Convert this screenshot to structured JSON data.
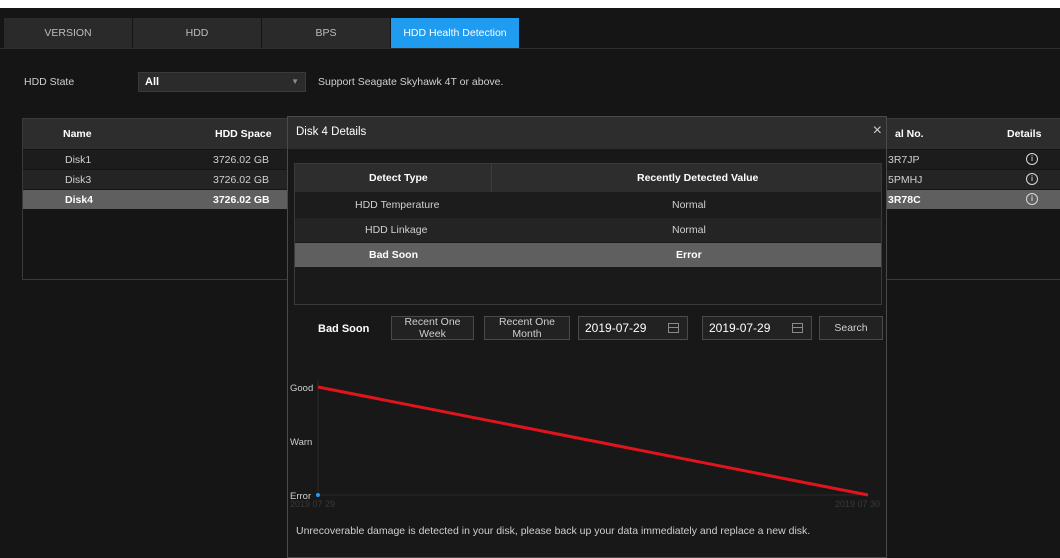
{
  "tabs": [
    {
      "label": "VERSION"
    },
    {
      "label": "HDD"
    },
    {
      "label": "BPS"
    },
    {
      "label": "HDD Health Detection"
    }
  ],
  "filter": {
    "state_label": "HDD State",
    "state_value": "All",
    "support_note": "Support Seagate Skyhawk 4T or above."
  },
  "disk_table": {
    "headers": {
      "name": "Name",
      "space": "HDD Space",
      "serial": "al No.",
      "details": "Details"
    },
    "rows": [
      {
        "name": "Disk1",
        "space": "3726.02 GB",
        "serial": "3R7JP"
      },
      {
        "name": "Disk3",
        "space": "3726.02 GB",
        "serial": "5PMHJ"
      },
      {
        "name": "Disk4",
        "space": "3726.02 GB",
        "serial": "3R78C"
      }
    ],
    "info_glyph": "i"
  },
  "modal": {
    "title": "Disk 4 Details",
    "close_glyph": "×",
    "table": {
      "headers": {
        "type": "Detect Type",
        "value": "Recently Detected Value"
      },
      "rows": [
        {
          "type": "HDD Temperature",
          "value": "Normal"
        },
        {
          "type": "HDD Linkage",
          "value": "Normal"
        },
        {
          "type": "Bad Soon",
          "value": "Error"
        }
      ]
    },
    "filter_label": "Bad Soon",
    "week_button": "Recent One Week",
    "month_button": "Recent One Month",
    "start_date": "2019-07-29",
    "end_date": "2019-07-29",
    "search_button": "Search",
    "footnote": "Unrecoverable damage is detected in your disk, please back up your data immediately and replace a new disk."
  },
  "chart_data": {
    "type": "line",
    "x_ticks": [
      "2019 07 29",
      "2019 07 30"
    ],
    "y_levels": [
      "Error",
      "Warn",
      "Good"
    ],
    "series": [
      {
        "color": "#e0141c",
        "points": [
          {
            "x": 0,
            "y": 2
          },
          {
            "x": 1,
            "y": 0
          }
        ]
      }
    ],
    "start_marker_color": "#1f9bf0",
    "grid": false
  }
}
